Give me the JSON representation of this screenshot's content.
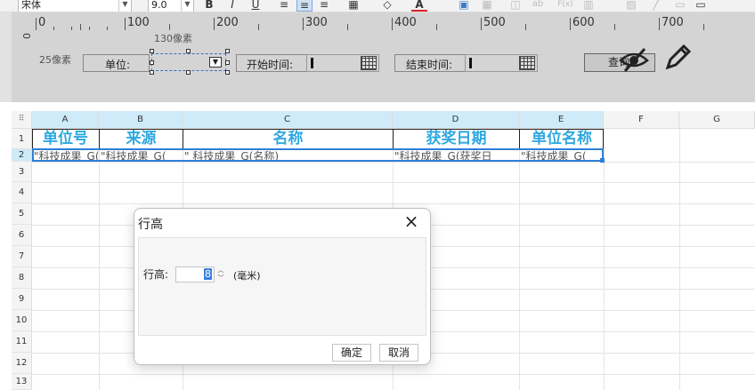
{
  "toolbar": {
    "font": "宋体",
    "font_size": "9.0",
    "bold": "B",
    "italic": "I",
    "underline": "U",
    "text_color_icon": "A",
    "btn_ab": "ab",
    "btn_fx": "F(x)"
  },
  "ruler": {
    "ticks": [
      "0",
      "100",
      "200",
      "300",
      "400",
      "500",
      "600",
      "700"
    ],
    "vertical_zero": "0"
  },
  "design": {
    "hint_130": "130像素",
    "hint_25": "25像素",
    "unit_label": "单位:",
    "start_label": "开始时间:",
    "end_label": "结束时间:",
    "query_label": "查询"
  },
  "grid": {
    "corner": "⠿",
    "columns": [
      "A",
      "B",
      "C",
      "D",
      "E",
      "F",
      "G"
    ],
    "rows": [
      "1",
      "2",
      "3",
      "4",
      "5",
      "6",
      "7",
      "8",
      "9",
      "10",
      "11",
      "12",
      "13"
    ],
    "headers": [
      "单位号",
      "来源",
      "名称",
      "获奖日期",
      "单位名称"
    ],
    "data_row": [
      "\"科技成果_G(",
      "\"科技成果_G(",
      "\"  科技成果_G(名称)",
      "\"科技成果_G(获奖日",
      "\"科技成果_G("
    ]
  },
  "dialog": {
    "title": "行高",
    "close": "×",
    "field_label": "行高:",
    "value": "8",
    "unit": "(毫米)",
    "ok": "确定",
    "cancel": "取消"
  },
  "colors": {
    "header_text": "#2ea8e0",
    "selection": "#2f7fd7",
    "selected_col_header": "#cfeaf8"
  }
}
